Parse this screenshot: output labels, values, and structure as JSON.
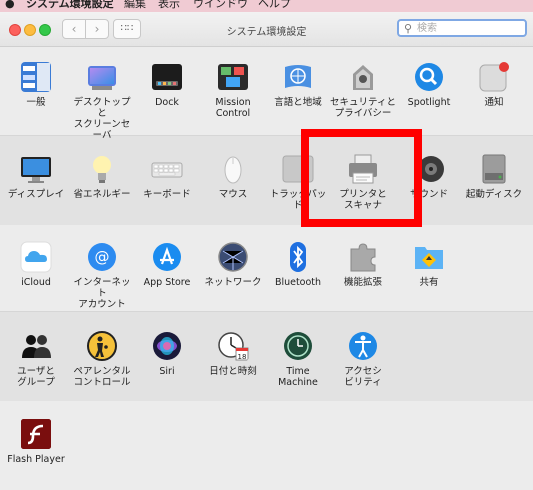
{
  "menubar": {
    "apple": "",
    "app_name": "システム環境設定",
    "items": [
      "編集",
      "表示",
      "ウインドウ",
      "ヘルプ"
    ]
  },
  "window": {
    "title": "システム環境設定",
    "search_placeholder": "検索"
  },
  "sections": [
    {
      "items": [
        {
          "label": "一般",
          "icon": "general-icon"
        },
        {
          "label": "デスクトップと\nスクリーンセーバ",
          "icon": "desktop-icon"
        },
        {
          "label": "Dock",
          "icon": "dock-icon"
        },
        {
          "label": "Mission\nControl",
          "icon": "mission-control-icon"
        },
        {
          "label": "言語と地域",
          "icon": "language-region-icon"
        },
        {
          "label": "セキュリティと\nプライバシー",
          "icon": "security-icon"
        },
        {
          "label": "Spotlight",
          "icon": "spotlight-icon"
        },
        {
          "label": "通知",
          "icon": "notifications-icon"
        }
      ]
    },
    {
      "items": [
        {
          "label": "ディスプレイ",
          "icon": "display-icon"
        },
        {
          "label": "省エネルギー",
          "icon": "energy-saver-icon"
        },
        {
          "label": "キーボード",
          "icon": "keyboard-icon"
        },
        {
          "label": "マウス",
          "icon": "mouse-icon"
        },
        {
          "label": "トラックパッド",
          "icon": "trackpad-icon"
        },
        {
          "label": "プリンタと\nスキャナ",
          "icon": "printer-icon"
        },
        {
          "label": "サウンド",
          "icon": "sound-icon"
        },
        {
          "label": "起動ディスク",
          "icon": "startup-disk-icon"
        }
      ]
    },
    {
      "items": [
        {
          "label": "iCloud",
          "icon": "icloud-icon"
        },
        {
          "label": "インターネット\nアカウント",
          "icon": "internet-accounts-icon"
        },
        {
          "label": "App Store",
          "icon": "app-store-icon"
        },
        {
          "label": "ネットワーク",
          "icon": "network-icon"
        },
        {
          "label": "Bluetooth",
          "icon": "bluetooth-icon"
        },
        {
          "label": "機能拡張",
          "icon": "extensions-icon"
        },
        {
          "label": "共有",
          "icon": "sharing-icon"
        }
      ]
    },
    {
      "items": [
        {
          "label": "ユーザと\nグループ",
          "icon": "users-groups-icon"
        },
        {
          "label": "ペアレンタル\nコントロール",
          "icon": "parental-controls-icon"
        },
        {
          "label": "Siri",
          "icon": "siri-icon"
        },
        {
          "label": "日付と時刻",
          "icon": "date-time-icon"
        },
        {
          "label": "Time\nMachine",
          "icon": "time-machine-icon"
        },
        {
          "label": "アクセシ\nビリティ",
          "icon": "accessibility-icon"
        }
      ]
    },
    {
      "items": [
        {
          "label": "Flash Player",
          "icon": "flash-player-icon"
        }
      ]
    }
  ],
  "highlight_color": "#ff0000"
}
